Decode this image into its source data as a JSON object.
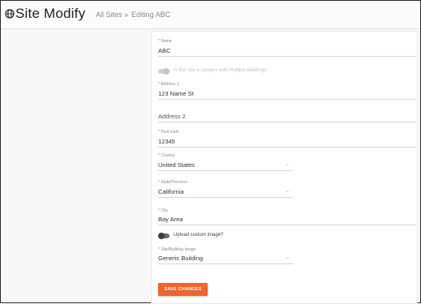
{
  "header": {
    "app_icon": "globe-icon",
    "title": "Site Modify",
    "breadcrumb": {
      "link": "All Sites",
      "separator": "»",
      "current": "Editing ABC"
    }
  },
  "form": {
    "name": {
      "label": "* Name",
      "value": "ABC"
    },
    "campus_toggle": {
      "label": "Is this site a campus with multiple buildings",
      "state": "off-disabled"
    },
    "address1": {
      "label": "* Address 1",
      "value": "123 Name St"
    },
    "address2": {
      "placeholder": "Address 2",
      "value": ""
    },
    "postcode": {
      "label": "* Post code",
      "value": "12345"
    },
    "country": {
      "label": "* Country",
      "value": "United States"
    },
    "state": {
      "label": "* State/Province",
      "value": "California"
    },
    "city": {
      "label": "* City",
      "value": "Bay Area"
    },
    "custom_image_toggle": {
      "label": "Upload custom image?",
      "state": "off"
    },
    "building_image": {
      "label": "* Site/Building Image",
      "value": "Generic Building"
    },
    "save_label": "SAVE CHANGES"
  },
  "colors": {
    "accent": "#f0642d",
    "toggle_off": "#555555",
    "toggle_disabled": "#c8c8c8"
  }
}
